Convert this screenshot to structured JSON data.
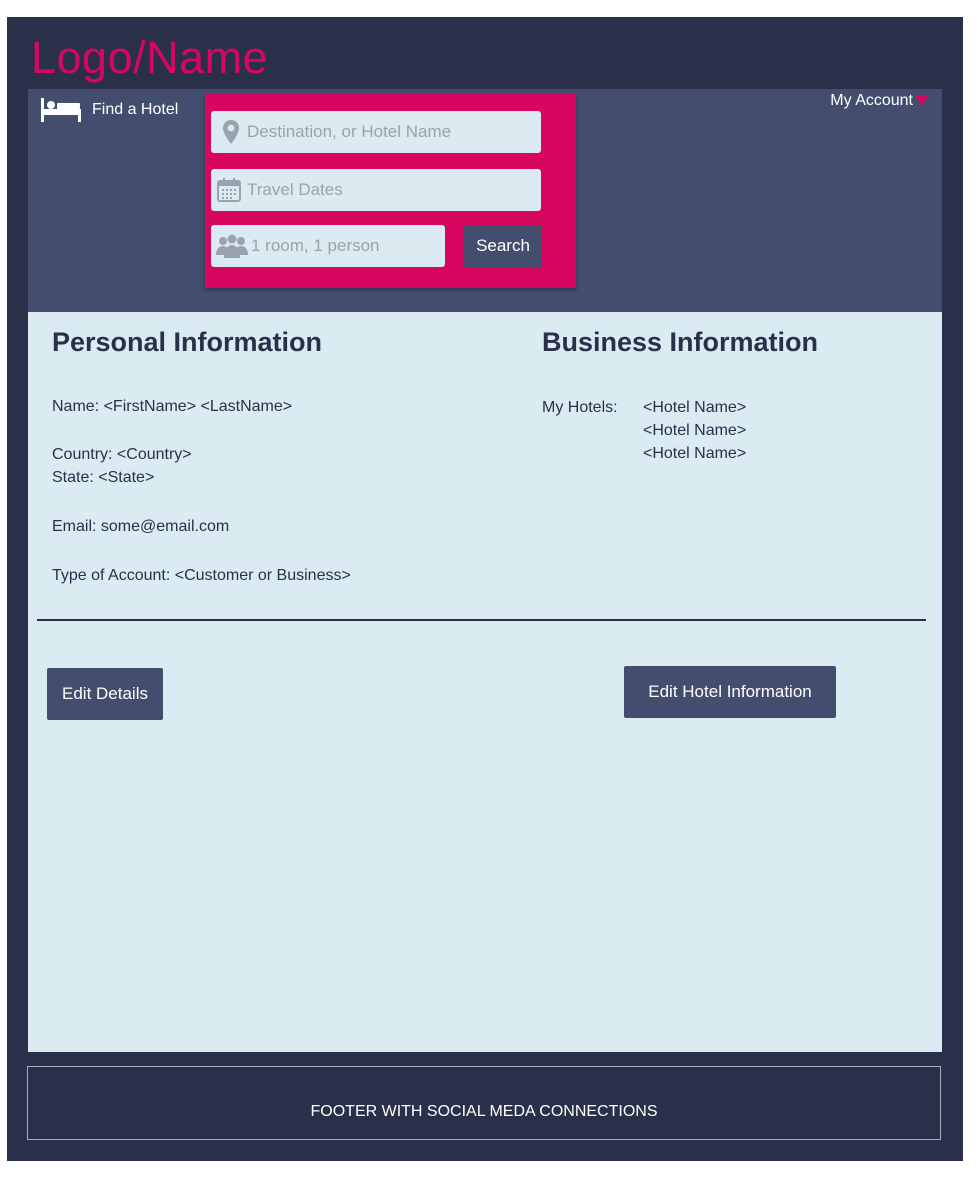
{
  "brand": {
    "logo_text": "Logo/Name",
    "accent": "#d7065f"
  },
  "nav": {
    "find_hotel_label": "Find a Hotel",
    "find_hotel_icon": "bed-icon",
    "my_account_label": "My Account",
    "my_account_icon": "caret-down-icon"
  },
  "search": {
    "destination_placeholder": "Destination, or Hotel Name",
    "destination_icon": "map-pin-icon",
    "dates_placeholder": "Travel Dates",
    "dates_icon": "calendar-icon",
    "guests_placeholder": "1 room, 1 person",
    "guests_icon": "people-icon",
    "search_label": "Search"
  },
  "personal": {
    "title": "Personal Information",
    "name": "Name: <FirstName> <LastName>",
    "country": "Country: <Country>",
    "state": "State: <State>",
    "email": "Email: some@email.com",
    "account_type": "Type of Account: <Customer or Business>",
    "edit_label": "Edit Details"
  },
  "business": {
    "title": "Business Information",
    "hotels_label": "My Hotels:",
    "hotels": [
      "<Hotel Name>",
      "<Hotel Name>",
      "<Hotel Name>"
    ],
    "edit_label": "Edit Hotel Information"
  },
  "footer": {
    "text": "FOOTER WITH SOCIAL MEDA CONNECTIONS"
  },
  "colors": {
    "frame": "#2a3049",
    "header": "#434d6e",
    "content": "#daebf2",
    "field": "#dbebf1"
  }
}
